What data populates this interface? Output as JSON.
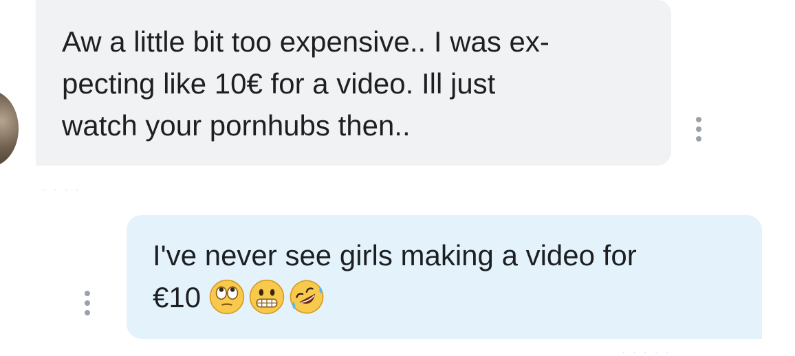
{
  "conversation": {
    "incoming_message": {
      "lines": [
        "Aw a little bit too expensive.. I was ex-",
        "pecting like 10€ for a video. Ill just",
        "watch your pornhubs then.."
      ]
    },
    "outgoing_message": {
      "line1": "I've never see girls making a video for",
      "line2_text": "€10",
      "emojis": [
        "face-with-rolling-eyes-icon",
        "grimacing-face-icon",
        "rolling-on-the-floor-laughing-icon"
      ]
    }
  },
  "colors": {
    "incoming_bubble": "#f1f2f4",
    "outgoing_bubble": "#e3f2fb",
    "text": "#1d1f22",
    "dots": "#9aa1a8"
  }
}
